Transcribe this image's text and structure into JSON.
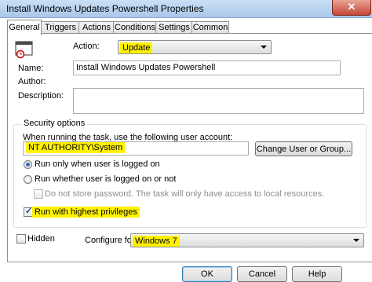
{
  "window": {
    "title": "Install Windows Updates Powershell Properties",
    "close_glyph": "✕"
  },
  "tabs": [
    {
      "label": "General",
      "active": true
    },
    {
      "label": "Triggers"
    },
    {
      "label": "Actions"
    },
    {
      "label": "Conditions"
    },
    {
      "label": "Settings"
    },
    {
      "label": "Common"
    }
  ],
  "general": {
    "action_label": "Action:",
    "action_value": "Update",
    "name_label": "Name:",
    "name_value": "Install Windows Updates Powershell",
    "author_label": "Author:",
    "description_label": "Description:"
  },
  "security": {
    "group_label": "Security options",
    "account_prompt": "When running the task, use the following user account:",
    "account_value": "NT AUTHORITY\\System",
    "change_button": "Change User or Group...",
    "radio_logged_on": "Run only when user is logged on",
    "radio_whether": "Run whether user is logged on or not",
    "no_store_password": "Do not store password. The task will only have access to local resources.",
    "highest_privileges": "Run with highest privileges"
  },
  "footer": {
    "hidden_label": "Hidden",
    "configure_label": "Configure for:",
    "configure_value": "Windows 7",
    "ok_button": "OK",
    "cancel_button": "Cancel",
    "help_button": "Help"
  },
  "colors": {
    "highlight": "#fff200",
    "accent": "#2d66c4"
  }
}
